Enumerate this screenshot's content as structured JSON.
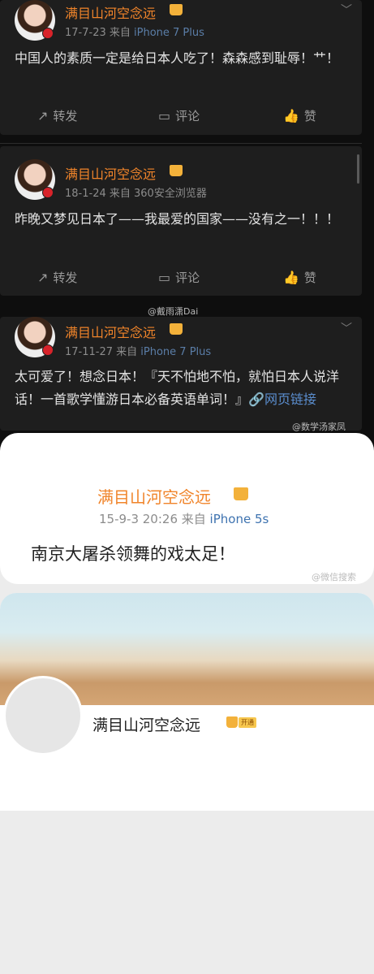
{
  "post1": {
    "name": "满目山河空念远",
    "meta": "17-7-23  来自",
    "via": "iPhone 7 Plus",
    "text": "中国人的素质一定是给日本人吃了！森森感到耻辱！艹！"
  },
  "post2": {
    "name": "满目山河空念远",
    "meta": "18-1-24  来自",
    "via": "360安全浏览器",
    "text": "昨晚又梦见日本了——我最爱的国家——没有之一！！！"
  },
  "post3": {
    "name": "满目山河空念远",
    "meta": "17-11-27  来自",
    "via": "iPhone 7 Plus",
    "text": "太可爱了！想念日本！『天不怕地不怕，就怕日本人说洋话！一首歌学懂游日本必备英语单词！』",
    "link": "网页链接"
  },
  "actions": {
    "repost": "转发",
    "comment": "评论",
    "like": "赞"
  },
  "watermarks": {
    "w1": "@戴雨潇Dai",
    "w2": "@数学汤家凤",
    "w3": "@微信搜索"
  },
  "post4": {
    "name": "满目山河空念远",
    "meta": "15-9-3 20:26  来自",
    "via": "iPhone 5s",
    "text": "南京大屠杀领舞的戏太足！"
  },
  "profile": {
    "name": "满目山河空念远",
    "badge": "开通"
  },
  "colors": {
    "name_orange": "#f0842a",
    "link_blue": "#5b8ecf",
    "dark_bg": "#1e1e1e"
  }
}
